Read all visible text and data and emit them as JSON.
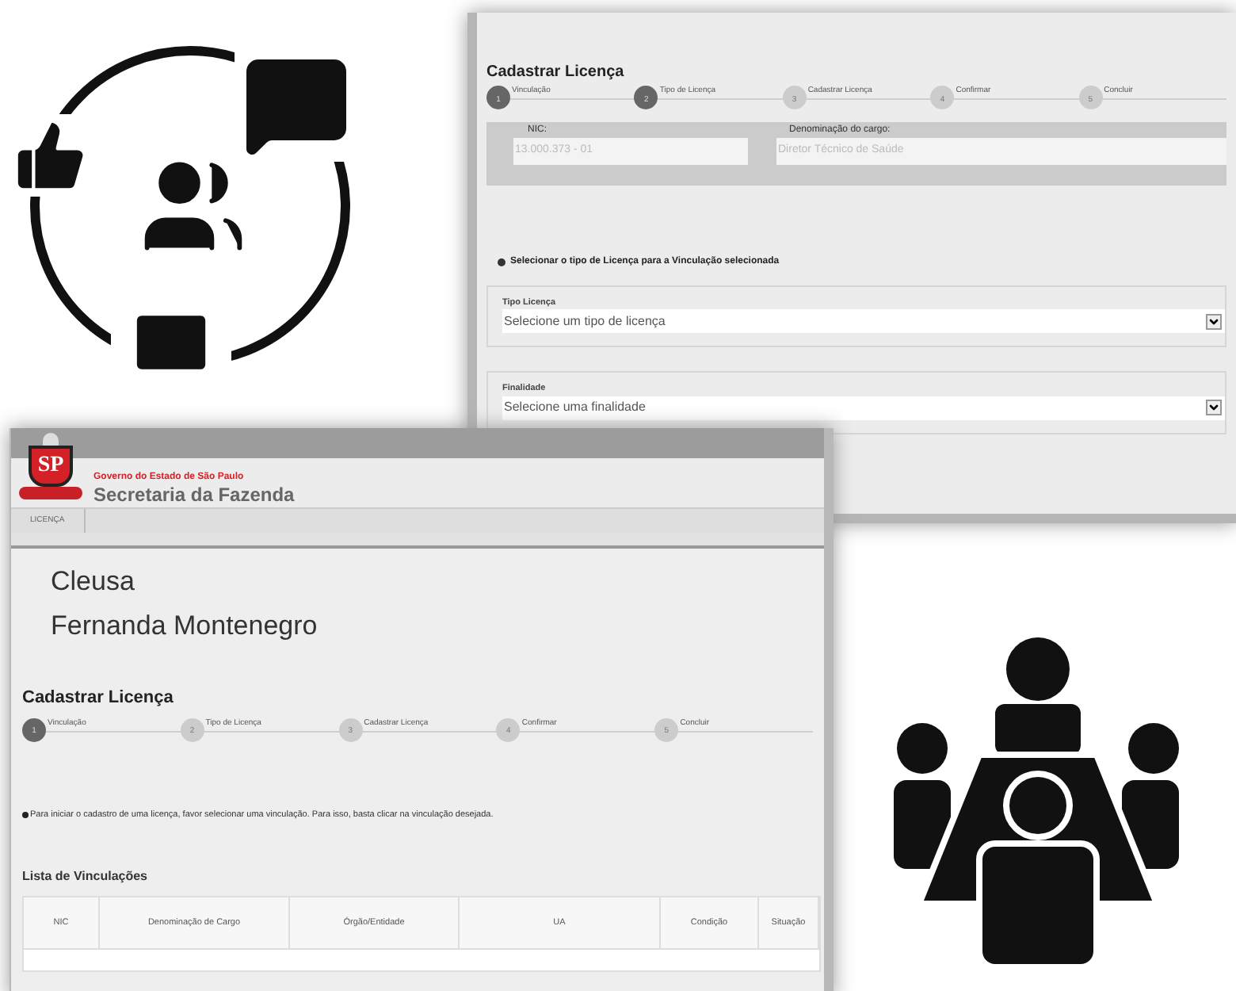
{
  "back_window": {
    "title": "Cadastrar Licença",
    "steps": [
      {
        "number": "1",
        "label": "Vinculação",
        "selected": true
      },
      {
        "number": "2",
        "label": "Tipo de Licença",
        "selected": true
      },
      {
        "number": "3",
        "label": "Cadastrar Licença",
        "selected": false
      },
      {
        "number": "4",
        "label": "Confirmar",
        "selected": false
      },
      {
        "number": "5",
        "label": "Concluir",
        "selected": false
      }
    ],
    "fields": [
      {
        "label": "NIC:",
        "value": "13.000.373 - 01"
      },
      {
        "label": "Denominação do cargo:",
        "value": "Diretor Técnico de Saúde"
      }
    ],
    "instruction": "Selecionar o tipo de Licença para a Vinculação selecionada",
    "selects": [
      {
        "label": "Tipo Licença",
        "placeholder": "Selecione um tipo de licença"
      },
      {
        "label": "Finalidade",
        "placeholder": "Selecione uma finalidade"
      }
    ]
  },
  "front_window": {
    "logo_text": "SP",
    "org": "Governo do Estado de São Paulo",
    "department": "Secretaria da Fazenda",
    "nav_items": [
      "LICENÇA"
    ],
    "user_lines": [
      "Cleusa",
      "Fernanda Montenegro"
    ],
    "title": "Cadastrar Licença",
    "steps": [
      {
        "number": "1",
        "label": "Vinculação",
        "selected": true
      },
      {
        "number": "2",
        "label": "Tipo de Licença",
        "selected": false
      },
      {
        "number": "3",
        "label": "Cadastrar Licença",
        "selected": false
      },
      {
        "number": "4",
        "label": "Confirmar",
        "selected": false
      },
      {
        "number": "5",
        "label": "Concluir",
        "selected": false
      }
    ],
    "notice": "Para iniciar o cadastro de uma licença, favor selecionar uma vinculação. Para isso, basta clicar na vinculação desejada.",
    "list_title": "Lista de Vinculações",
    "table": {
      "columns": [
        "NIC",
        "Denominação de Cargo",
        "Órgão/Entidade",
        "UA",
        "Condição",
        "Situação"
      ]
    }
  }
}
